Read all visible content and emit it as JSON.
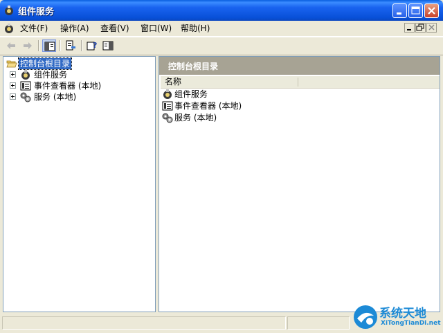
{
  "window": {
    "title": "组件服务"
  },
  "menubar": {
    "items": [
      {
        "label": "文件(F)"
      },
      {
        "label": "操作(A)"
      },
      {
        "label": "查看(V)"
      },
      {
        "label": "窗口(W)"
      },
      {
        "label": "帮助(H)"
      }
    ]
  },
  "toolbar": {
    "buttons": [
      "back-arrow-icon",
      "forward-arrow-icon",
      "show-hide-tree-icon",
      "export-list-icon",
      "help-icon",
      "show-hide-action-pane-icon"
    ]
  },
  "tree": {
    "root": {
      "label": "控制台根目录",
      "icon": "folder-open-icon",
      "selected": true
    },
    "children": [
      {
        "label": "组件服务",
        "icon": "component-services-icon"
      },
      {
        "label": "事件查看器 (本地)",
        "icon": "event-viewer-icon"
      },
      {
        "label": "服务 (本地)",
        "icon": "services-gears-icon"
      }
    ]
  },
  "rightpane": {
    "header": "控制台根目录",
    "column_name": "名称",
    "items": [
      {
        "label": "组件服务",
        "icon": "component-services-icon"
      },
      {
        "label": "事件查看器 (本地)",
        "icon": "event-viewer-icon"
      },
      {
        "label": "服务 (本地)",
        "icon": "services-gears-icon"
      }
    ]
  },
  "watermark": {
    "text": "系统天地",
    "url": "XiTongTianDi.net"
  },
  "colors": {
    "titlebar": "#0a5fe0",
    "selection": "#316ac5",
    "pane_header": "#a7a394"
  }
}
